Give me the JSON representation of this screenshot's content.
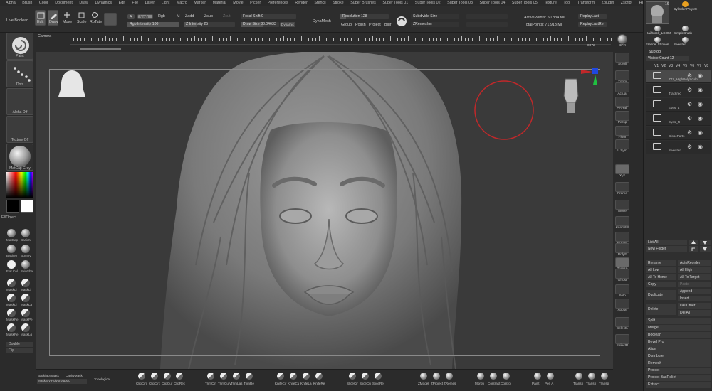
{
  "menu": [
    "Alpha",
    "Brush",
    "Color",
    "Document",
    "Draw",
    "Dynamics",
    "Edit",
    "File",
    "Layer",
    "Light",
    "Macro",
    "Marker",
    "Material",
    "Movie",
    "Picker",
    "Preferences",
    "Render",
    "Stencil",
    "Stroke",
    "Super Brushes",
    "Super Tools 01",
    "Super Tools 02",
    "Super Tools 03",
    "Super Tools 04",
    "Super Tools 05",
    "Texture",
    "Tool",
    "Transform",
    "Zplugin",
    "Zscript",
    "Help"
  ],
  "topshelf": {
    "live_boolean": "Live Boolean",
    "edit": "Edit",
    "draw": "Draw",
    "move": "Move",
    "scale": "Scale",
    "rotate": "RoTate",
    "a_btn": "A",
    "mrgb": "Mrgb",
    "rgb": "Rgb",
    "m": "M",
    "zadd": "Zadd",
    "zsub": "Zsub",
    "zcut": "Zcut",
    "rgb_intensity": "Rgb Intensity 100",
    "z_intensity": "Z Intensity 25",
    "focal_shift": "Focal Shift 0",
    "draw_size": "Draw Size 33.04633",
    "dynamic": "Dynamic",
    "dynamesh": "DynaMesh",
    "resolution": "Resolution 128",
    "group": "Group",
    "polish": "Polish",
    "project": "Project",
    "blur": "Blur",
    "subdivide_size": "Subdivide Size",
    "zremesher": "ZRemesher",
    "active_points": "ActivePoints: 50.834 Mil",
    "total_points": "TotalPoints: 71.913 Mil",
    "replay_last": "ReplayLast",
    "replay_last_rel": "ReplayLastRel"
  },
  "ruler": {
    "camera": "Camera",
    "value": "0072"
  },
  "left": {
    "brush": "Paint",
    "stroke": "Dots",
    "alpha": "Alpha Off",
    "texture": "Texture Off",
    "material": "MatCap Gray",
    "fill": "FillObject",
    "materials": [
      "MatCap",
      "BasicM",
      "BasicM",
      "BumpV",
      "Flat Col",
      "SkinSha"
    ],
    "masks": [
      "MaskLi",
      "MaskLi",
      "MaskLi",
      "MaskLa",
      "MaskPe",
      "MaskPe",
      "MaskPe",
      "MaskLg"
    ],
    "double": "Double",
    "flip": "Flip"
  },
  "rightbar": [
    "BPR",
    "Scroll",
    "Zoom",
    "Actual",
    "AAHalf",
    "Persp",
    "Floor",
    "L.Sym",
    "Xyz",
    "Frame",
    "Move",
    "Zoom3D",
    "Rotate",
    "PolyF",
    "Transp",
    "Ghost",
    "Solo",
    "Xpose",
    "SelectL",
    "SelectR"
  ],
  "subtool": {
    "tool_thumbs": [
      "Hairblock_LCOM",
      "Cylinder PolyMe",
      "Fresnel Strokes",
      "SimpleBrush",
      "Sweater"
    ],
    "count": "16",
    "header": "Subtool",
    "visible_count": "Visible Count 12",
    "versions": [
      "V1",
      "V2",
      "V3",
      "V4",
      "V5",
      "V6",
      "V7",
      "V8"
    ],
    "items": [
      {
        "name": "ZTL_HighPolySculpt",
        "selected": true
      },
      {
        "name": "Trackrec",
        "selected": false
      },
      {
        "name": "Eyes_L",
        "selected": false
      },
      {
        "name": "Eyes_R",
        "selected": false
      },
      {
        "name": "CloseParts",
        "selected": false
      },
      {
        "name": "Sweater",
        "selected": false
      }
    ],
    "list_all": "List All",
    "new_folder": "New Folder",
    "rename": "Rename",
    "autoreorder": "AutoReorder",
    "all_low": "All Low",
    "all_high": "All High",
    "all_to_home": "All To Home",
    "all_to_target": "All To Target",
    "copy": "Copy",
    "paste": "Paste",
    "duplicate": "Duplicate",
    "append": "Append",
    "insert": "Insert",
    "delete": "Delete",
    "del_other": "Del Other",
    "del_all": "Del All",
    "menu": [
      "Split",
      "Merge",
      "Boolean",
      "Bevel Pro",
      "Align",
      "Distribute",
      "Remesh",
      "Project",
      "Project BasRelief",
      "Extract"
    ]
  },
  "bottom": {
    "backface": "BackfaceMask",
    "cavity": "CavityMask",
    "mask_polygroups": "Mask By Polygroups 0",
    "topological": "Topological",
    "tools": [
      "ClipCirc",
      "ClipCirc",
      "ClipCur",
      "ClipRec",
      "TrimCir",
      "TrimCurv",
      "TrimLas",
      "TrimRe",
      "KnifeCir",
      "KnifeCu",
      "KnifeLa",
      "KnifeRe",
      "SliceCir",
      "SliceCu",
      "SliceRe",
      "ZModel",
      "ZProject",
      "ZRemes",
      "Morph",
      "Contrast",
      "Control",
      "Paint",
      "Pen A",
      "Transp",
      "Transp",
      "Transp"
    ]
  },
  "colors": {
    "accent_red": "#c0282a",
    "gizmo_blue": "#2048e0",
    "gizmo_green": "#20c040"
  }
}
